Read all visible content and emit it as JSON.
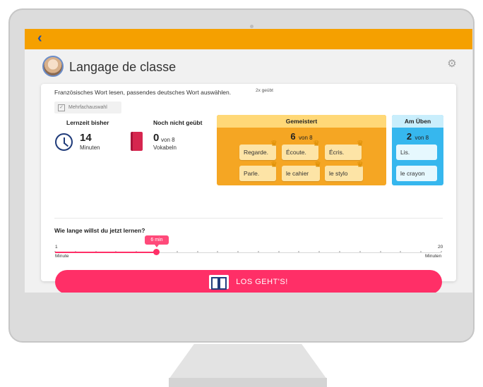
{
  "header": {
    "back_icon": "chevron-left-icon",
    "back_glyph": "‹",
    "color": "#f5a000"
  },
  "lesson": {
    "title": "Langage de classe",
    "settings_glyph": "⚙"
  },
  "exercise": {
    "description": "Französisches Wort lesen, passendes deutsches Wort auswählen.",
    "practiced": "2x geübt",
    "mode_label": "Mehrfachauswahl"
  },
  "stats": {
    "study_time": {
      "heading": "Lernzeit bisher",
      "value": "14",
      "unit": "Minuten"
    },
    "not_practiced": {
      "heading": "Noch nicht geübt",
      "value": "0",
      "of": "von 8",
      "unit": "Vokabeln"
    }
  },
  "mastered": {
    "heading": "Gemeistert",
    "count": "6",
    "of": "von 8",
    "words": [
      "Regarde.",
      "Écoute.",
      "Écris.",
      "Parle.",
      "le cahier",
      "le stylo"
    ],
    "crown_glyph": "♛",
    "color": "#f5a623"
  },
  "practicing": {
    "heading": "Am Üben",
    "count": "2",
    "of": "von 8",
    "words": [
      "Lis.",
      "le crayon"
    ],
    "color": "#36b7ee"
  },
  "duration": {
    "question": "Wie lange willst du jetzt lernen?",
    "min_value": "1",
    "min_label": "Minute",
    "max_value": "20",
    "max_label": "Minuten",
    "current_label": "6 min",
    "current_value": 6,
    "min": 1,
    "max": 20
  },
  "start_button": {
    "label": "LOS GEHT'S!",
    "icon": "open-book-icon",
    "color": "#ff2f67"
  }
}
